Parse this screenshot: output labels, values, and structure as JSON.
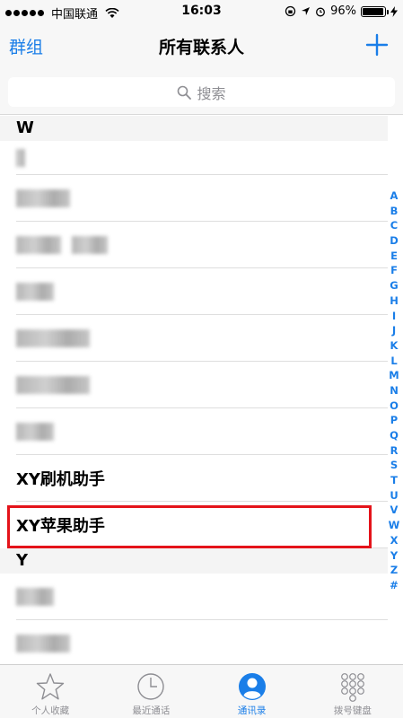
{
  "status_bar": {
    "carrier": "中国联通",
    "time": "16:03",
    "battery": "96%"
  },
  "nav": {
    "left_label": "群组",
    "title": "所有联系人"
  },
  "search": {
    "placeholder": "搜索"
  },
  "sections": [
    {
      "letter": "W"
    },
    {
      "letter": "Y"
    }
  ],
  "contacts": {
    "xy_flash": "XY刷机助手",
    "xy_apple": "XY苹果助手"
  },
  "alpha_index": [
    "A",
    "B",
    "C",
    "D",
    "E",
    "F",
    "G",
    "H",
    "I",
    "J",
    "K",
    "L",
    "M",
    "N",
    "O",
    "P",
    "Q",
    "R",
    "S",
    "T",
    "U",
    "V",
    "W",
    "X",
    "Y",
    "Z",
    "#"
  ],
  "tabs": [
    {
      "label": "个人收藏",
      "icon": "star-icon"
    },
    {
      "label": "最近通话",
      "icon": "clock-icon"
    },
    {
      "label": "通讯录",
      "icon": "contacts-icon",
      "active": true
    },
    {
      "label": "拨号键盘",
      "icon": "keypad-icon"
    }
  ],
  "colors": {
    "accent": "#1a7ee8",
    "highlight": "#e4131a"
  }
}
